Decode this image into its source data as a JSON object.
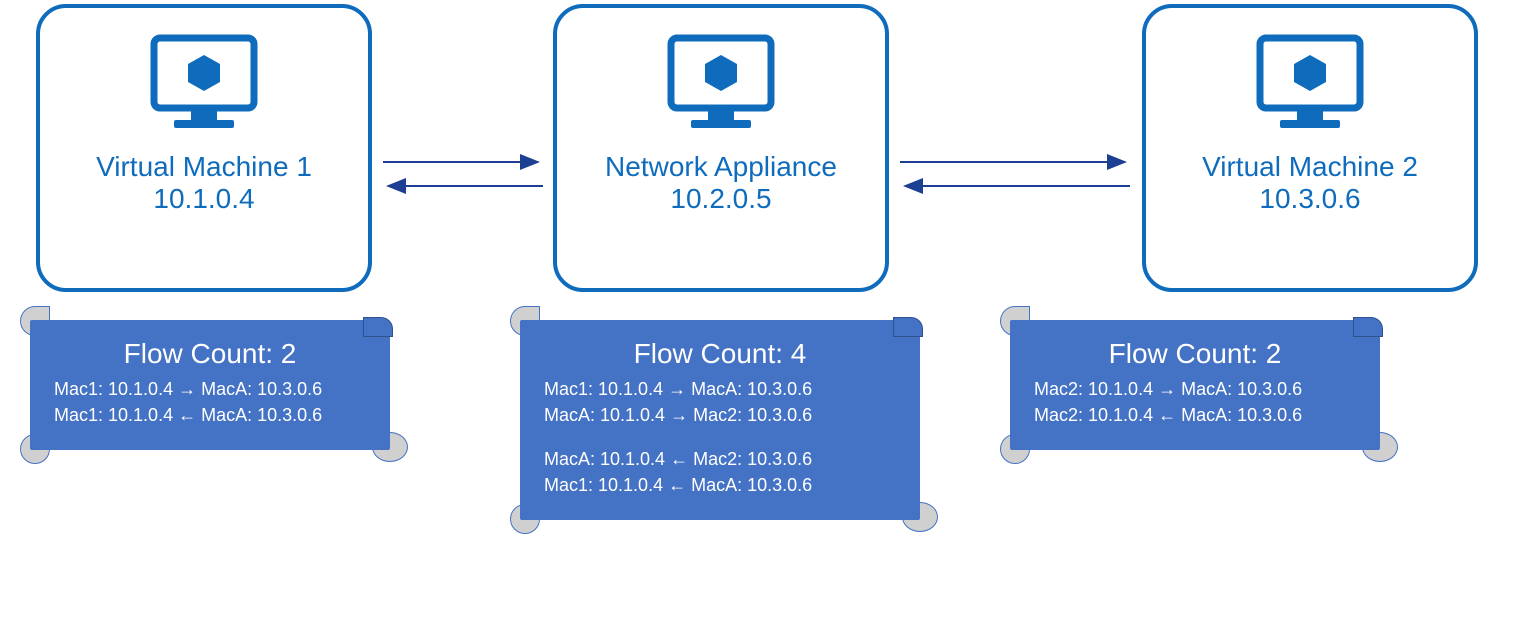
{
  "nodes": {
    "vm1": {
      "title": "Virtual Machine 1",
      "ip": "10.1.0.4"
    },
    "na": {
      "title": "Network Appliance",
      "ip": "10.2.0.5"
    },
    "vm2": {
      "title": "Virtual Machine 2",
      "ip": "10.3.0.6"
    }
  },
  "panels": {
    "p1": {
      "title": "Flow Count: 2",
      "lines": [
        "Mac1: 10.1.0.4 → MacA: 10.3.0.6",
        "Mac1: 10.1.0.4 ← MacA: 10.3.0.6"
      ]
    },
    "p2": {
      "title": "Flow Count: 4",
      "lines_top": [
        "Mac1: 10.1.0.4 → MacA: 10.3.0.6",
        "MacA: 10.1.0.4 → Mac2: 10.3.0.6"
      ],
      "lines_bottom": [
        "MacA: 10.1.0.4 ← Mac2: 10.3.0.6",
        "Mac1: 10.1.0.4 ← MacA: 10.3.0.6"
      ]
    },
    "p3": {
      "title": "Flow Count: 2",
      "lines": [
        "Mac2: 10.1.0.4 → MacA: 10.3.0.6",
        "Mac2: 10.1.0.4 ← MacA: 10.3.0.6"
      ]
    }
  }
}
